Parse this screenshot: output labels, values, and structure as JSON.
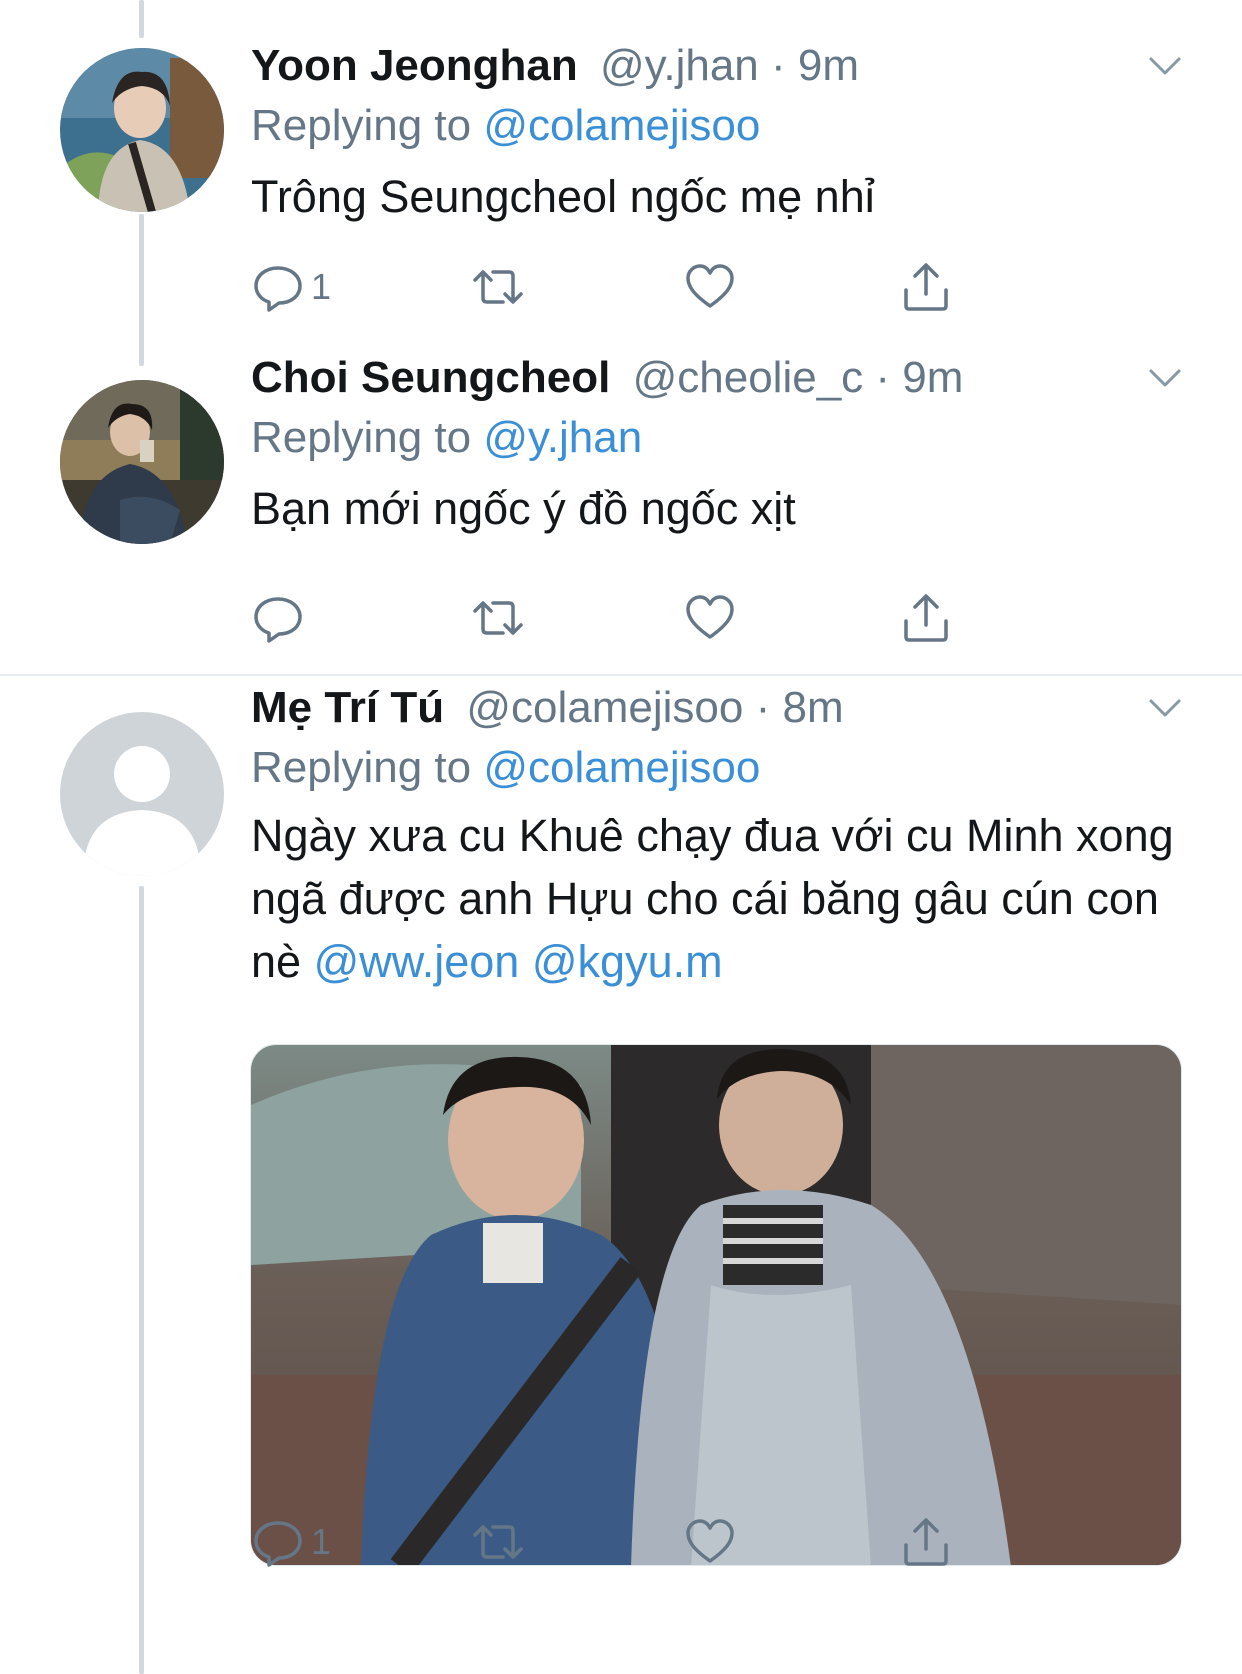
{
  "tweets": [
    {
      "name": "Yoon Jeonghan",
      "handle": "@y.jhan",
      "sep": "·",
      "time": "9m",
      "replying_prefix": "Replying to ",
      "replying_to": "@colamejisoo",
      "text": "Trông Seungcheol ngốc mẹ nhỉ",
      "reply_count": "1"
    },
    {
      "name": "Choi Seungcheol",
      "handle": "@cheolie_c",
      "sep": "·",
      "time": "9m",
      "replying_prefix": "Replying to ",
      "replying_to": "@y.jhan",
      "text": "Bạn mới ngốc ý đồ ngốc xịt",
      "reply_count": ""
    },
    {
      "name": "Mẹ Trí Tú",
      "handle": "@colamejisoo",
      "sep": "·",
      "time": "8m",
      "replying_prefix": "Replying to ",
      "replying_to": "@colamejisoo",
      "text": "Ngày xưa cu Khuê chạy đua với cu Minh xong ngã được anh Hựu cho cái băng gâu cún con nè ",
      "mention_1": "@ww.jeon",
      "mention_2": "@kgyu.m",
      "reply_count": "1",
      "has_photo": true
    }
  ],
  "icons": [
    "reply-icon",
    "retweet-icon",
    "like-icon",
    "share-icon",
    "chevron-down-icon",
    "default-avatar-icon"
  ],
  "colors": {
    "text": "#14171a",
    "secondary": "#657786",
    "link": "#3b8fd6",
    "thread_line": "#cfd9de",
    "divider": "#e6ecf0"
  }
}
